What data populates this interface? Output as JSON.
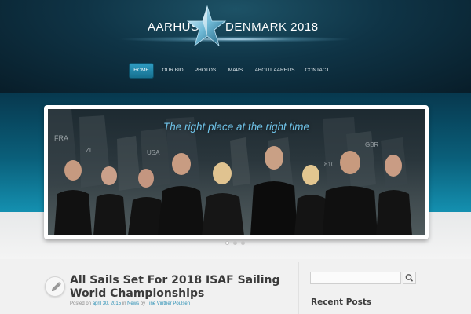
{
  "logo": {
    "left": "AARHUS",
    "right": "DENMARK 2018"
  },
  "nav": {
    "items": [
      {
        "label": "HOME",
        "active": true
      },
      {
        "label": "OUR BID",
        "active": false
      },
      {
        "label": "PHOTOS",
        "active": false
      },
      {
        "label": "MAPS",
        "active": false
      },
      {
        "label": "ABOUT AARHUS",
        "active": false
      },
      {
        "label": "CONTACT",
        "active": false
      }
    ]
  },
  "slider": {
    "caption": "The right place at the right time",
    "dots": 3,
    "active_dot": 1,
    "sail_numbers": [
      "FRA",
      "ZL",
      "USA",
      "810",
      "GBR"
    ]
  },
  "post": {
    "title": "All Sails Set For 2018 ISAF Sailing World Championships",
    "meta_prefix": "Posted on",
    "date": "april 30, 2015",
    "in_label": "in",
    "category": "News",
    "by_label": "by",
    "author": "Tine Vinther Poulsen",
    "icon": "pencil-icon"
  },
  "sidebar": {
    "search_placeholder": "",
    "search_icon": "search-icon",
    "recent_posts_title": "Recent Posts"
  },
  "colors": {
    "header_dark": "#081d29",
    "header_teal": "#1490b0",
    "accent": "#2a8fb4",
    "caption": "#6fc3e8"
  }
}
